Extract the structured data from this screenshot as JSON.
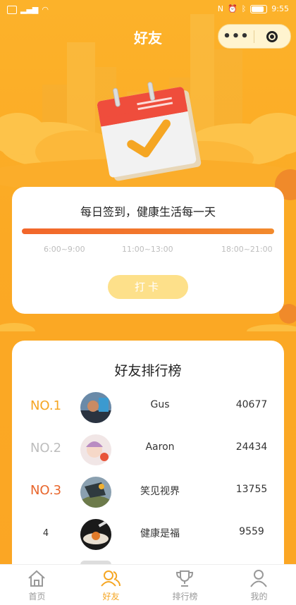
{
  "status_bar": {
    "time": "9:55",
    "battery": "80"
  },
  "header": {
    "title": "好友",
    "capsule_more": "•••"
  },
  "checkin": {
    "headline": "每日签到，健康生活每一天",
    "time_slots": [
      "6:00~9:00",
      "11:00~13:00",
      "18:00~21:00"
    ],
    "button_label": "打卡"
  },
  "ranking": {
    "title": "好友排行榜",
    "rows": [
      {
        "rank": "NO.1",
        "name": "Gus",
        "score": "40677",
        "color": "#f5a623"
      },
      {
        "rank": "NO.2",
        "name": "Aaron",
        "score": "24434",
        "color": "#bdbdbd"
      },
      {
        "rank": "NO.3",
        "name": "笑见视界",
        "score": "13755",
        "color": "#e8662c"
      },
      {
        "rank": "4",
        "name": "健康是福",
        "score": "9559",
        "color": "#333333"
      }
    ]
  },
  "tabbar": {
    "items": [
      {
        "label": "首页",
        "icon": "home-icon",
        "active": false
      },
      {
        "label": "好友",
        "icon": "friends-icon",
        "active": true
      },
      {
        "label": "排行榜",
        "icon": "trophy-icon",
        "active": false
      },
      {
        "label": "我的",
        "icon": "user-icon",
        "active": false
      }
    ]
  },
  "colors": {
    "accent": "#f5a623",
    "background": "#fbab26",
    "progress": "#f2662b"
  }
}
